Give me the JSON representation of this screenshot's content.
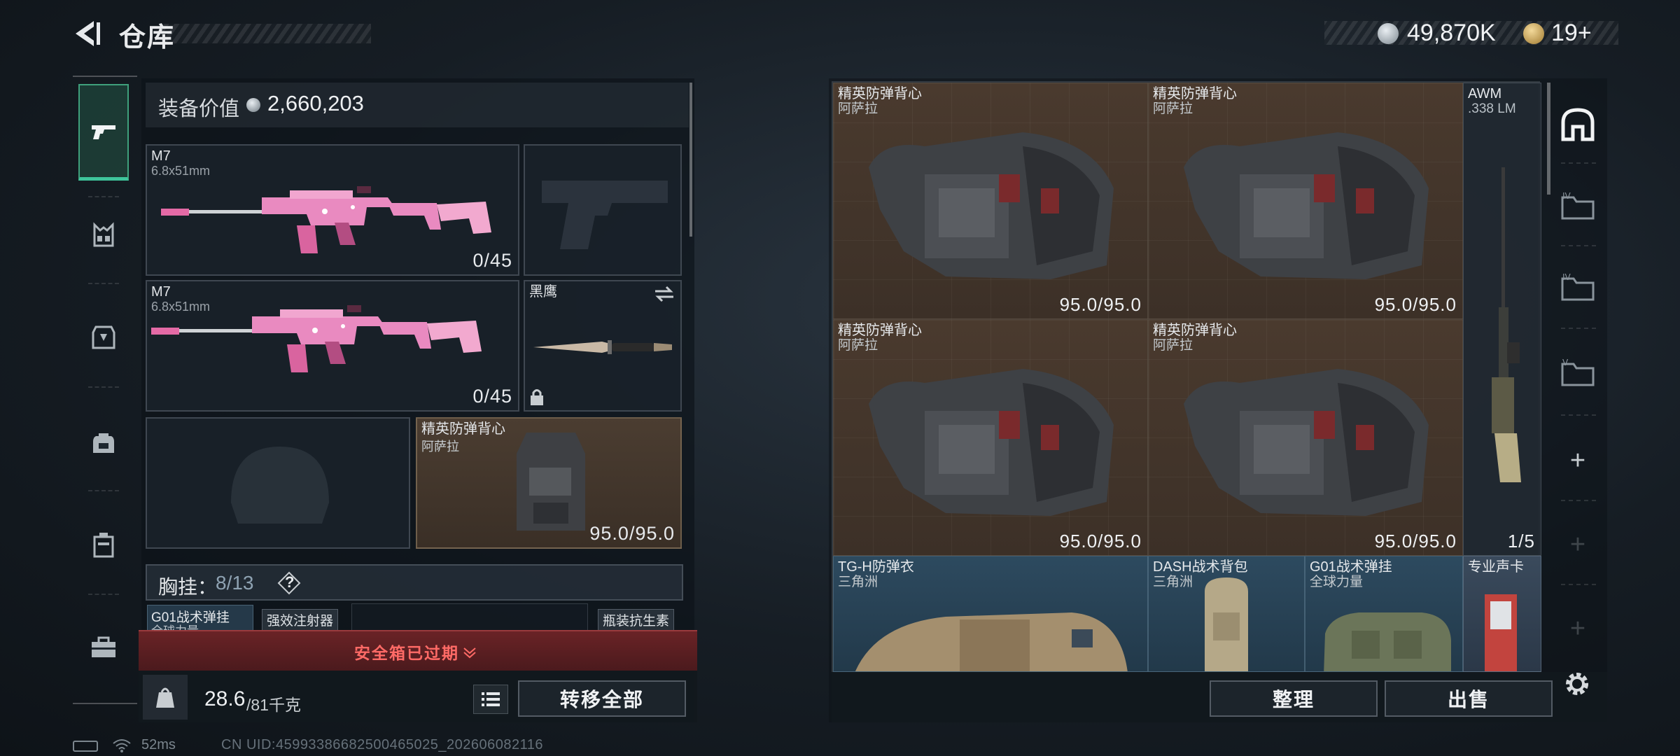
{
  "header": {
    "title": "仓库",
    "currency_main": "49,870K",
    "currency_secondary": "19+"
  },
  "equip": {
    "label": "装备价值",
    "value": "2,660,203"
  },
  "loadout": {
    "primary1": {
      "name": "M7",
      "ammo_type": "6.8x51mm",
      "amount": "0/45"
    },
    "primary2": {
      "name": "M7",
      "ammo_type": "6.8x51mm",
      "amount": "0/45"
    },
    "melee": {
      "name": "黑鹰"
    },
    "armor": {
      "name": "精英防弹背心",
      "map": "阿萨拉",
      "durability": "95.0/95.0"
    }
  },
  "chest_rig": {
    "label": "胸挂：",
    "count": "8/13",
    "help": "?",
    "items": {
      "g01_name": "G01战术弹挂",
      "g01_sub": "全球力量",
      "inject": "强效注射器",
      "antibiotic": "瓶装抗生素"
    }
  },
  "safe_box": {
    "text": "安全箱已过期"
  },
  "weight": {
    "current": "28.6",
    "max": "/81千克"
  },
  "actions": {
    "transfer_all": "转移全部",
    "sort": "整理",
    "sell": "出售"
  },
  "storage": {
    "vests": [
      {
        "name": "精英防弹背心",
        "map": "阿萨拉",
        "durability": "95.0/95.0"
      },
      {
        "name": "精英防弹背心",
        "map": "阿萨拉",
        "durability": "95.0/95.0"
      },
      {
        "name": "精英防弹背心",
        "map": "阿萨拉",
        "durability": "95.0/95.0"
      },
      {
        "name": "精英防弹背心",
        "map": "阿萨拉",
        "durability": "95.0/95.0"
      }
    ],
    "awm": {
      "name": "AWM",
      "ammo_type": ".338 LM",
      "amount": "1/5"
    },
    "tgh": {
      "name": "TG-H防弹衣",
      "map": "三角洲"
    },
    "dash": {
      "name": "DASH战术背包",
      "map": "三角洲"
    },
    "g01": {
      "name": "G01战术弹挂",
      "map": "全球力量"
    },
    "card": {
      "name": "专业声卡"
    }
  },
  "status": {
    "ping": "52ms",
    "uid": "CN UID:45993386682500465025_202606082116"
  },
  "colors": {
    "accent_green": "#3ec49a",
    "warning_red": "#ff6a66",
    "rarity_brown": "#4a3a2e",
    "rarity_blue": "#2d4a5f"
  }
}
